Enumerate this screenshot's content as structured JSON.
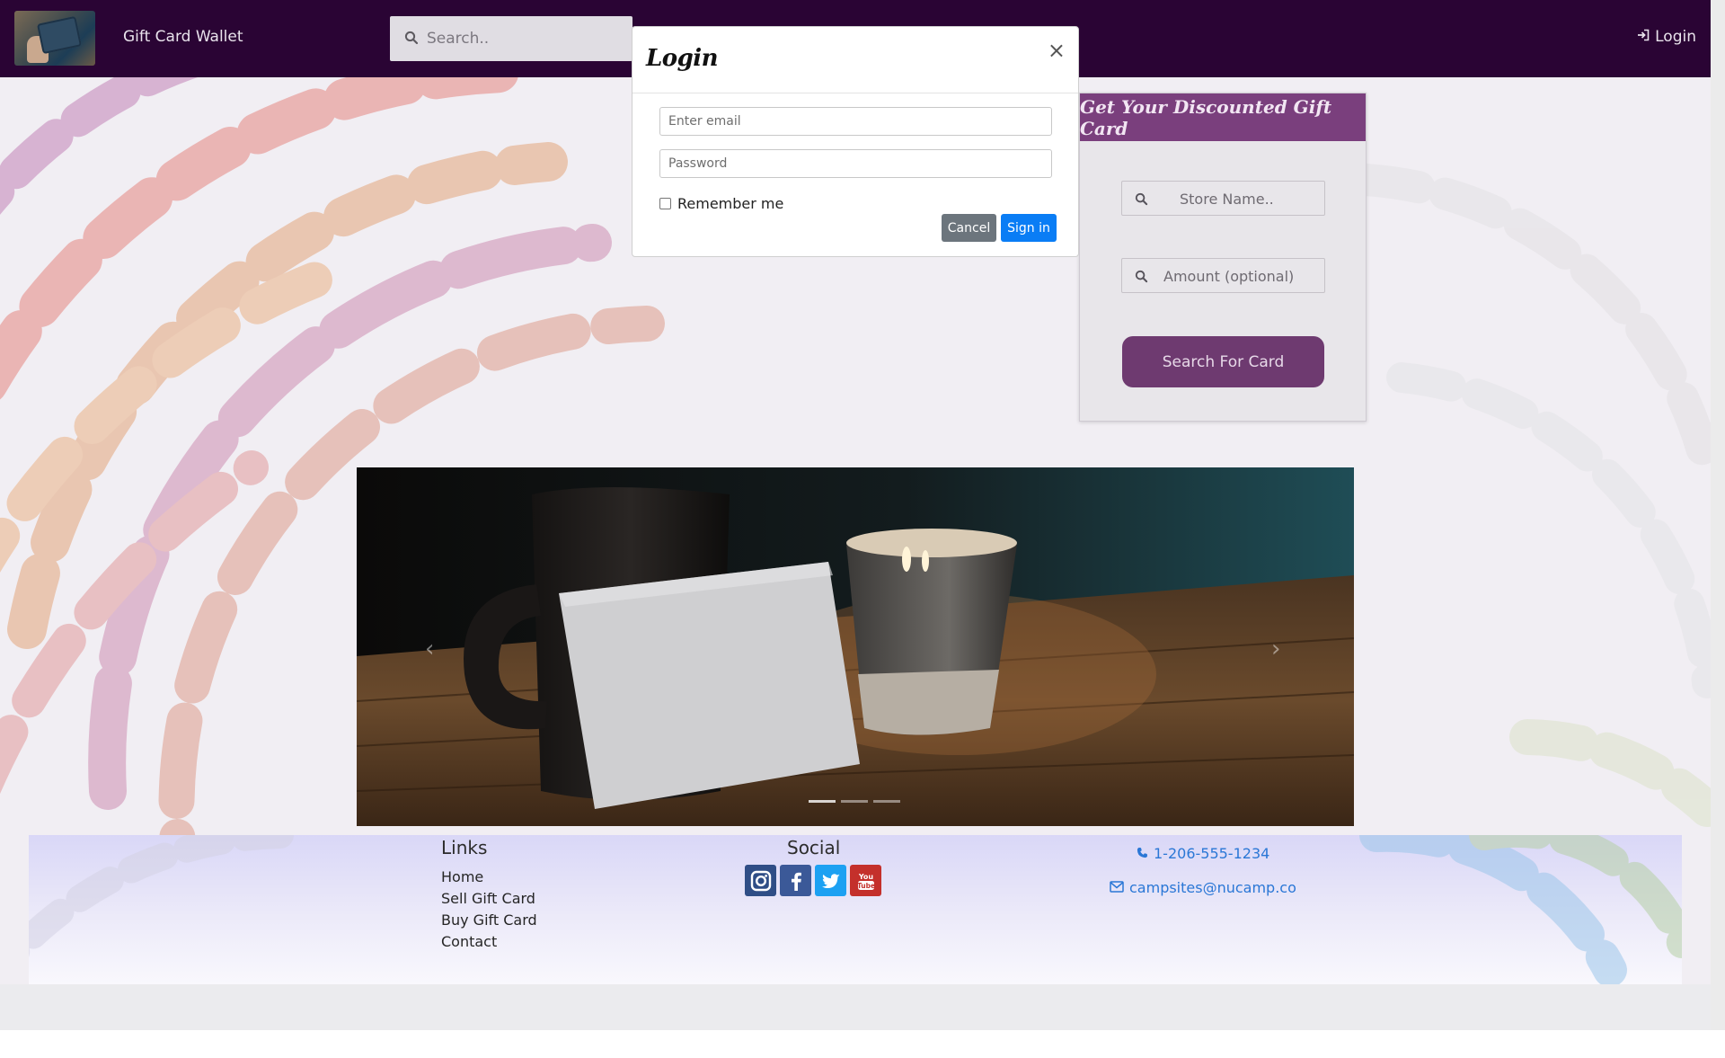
{
  "navbar": {
    "brand": "Gift Card Wallet",
    "search_placeholder": "Search..",
    "login": "Login",
    "bg_color": "#2a0434"
  },
  "login_modal": {
    "title": "Login",
    "close": "×",
    "email_placeholder": "Enter email",
    "password_placeholder": "Password",
    "remember_label": "Remember me",
    "cancel": "Cancel",
    "sign_in": "Sign in"
  },
  "discount": {
    "title": "Get Your Discounted Gift Card",
    "store_placeholder": "Store Name..",
    "amount_placeholder": "Amount (optional)",
    "button": "Search For Card",
    "accent": "#7a3f7d"
  },
  "carousel": {
    "prev": "‹",
    "next": "›",
    "slides": 3,
    "active_slide": 1
  },
  "footer": {
    "links_heading": "Links",
    "links": [
      "Home",
      "Sell Gift Card",
      "Buy Gift Card",
      "Contact"
    ],
    "social_heading": "Social",
    "social_icons": [
      "instagram-icon",
      "facebook-icon",
      "twitter-icon",
      "youtube-icon"
    ],
    "phone": "1-206-555-1234",
    "email": "campsites@nucamp.co",
    "link_color": "#2a77d6"
  }
}
